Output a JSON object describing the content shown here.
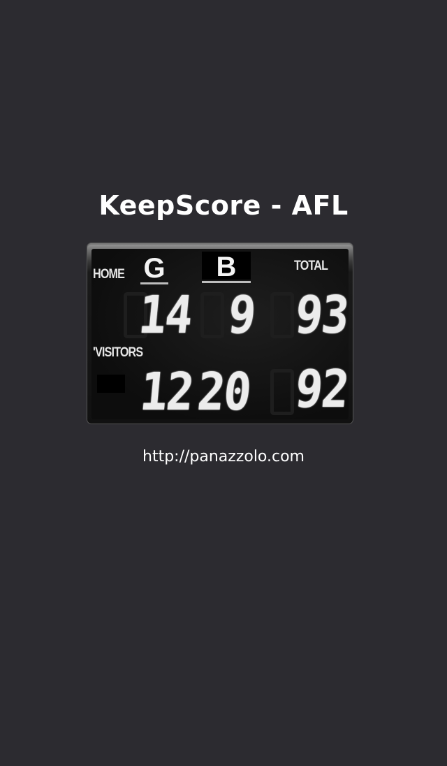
{
  "app": {
    "title": "KeepScore - AFL",
    "url": "http://panazzolo.com"
  },
  "scoreboard": {
    "headers": {
      "goals": "G",
      "behinds": "B",
      "total": "TOTAL"
    },
    "home": {
      "label": "HOME",
      "goals": "14",
      "behinds": "9",
      "total": "93"
    },
    "visitors": {
      "label": "'VISITORS",
      "goals": "12",
      "behinds": "20",
      "total": "92"
    }
  }
}
